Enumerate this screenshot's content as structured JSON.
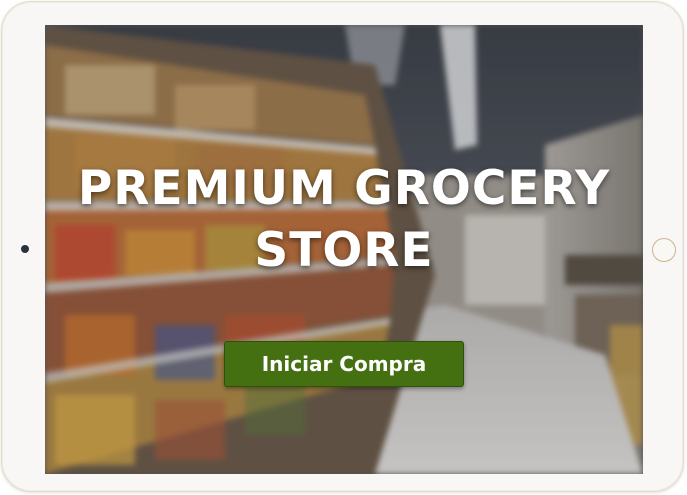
{
  "hero": {
    "title_line1": "PREMIUM GROCERY",
    "title_line2": "STORE"
  },
  "cta": {
    "label": "Iniciar Compra",
    "color": "#447012"
  },
  "device": {
    "frame_color": "#f8f7f5",
    "home_button_icon": "home-button-icon",
    "camera_icon": "camera-icon"
  }
}
